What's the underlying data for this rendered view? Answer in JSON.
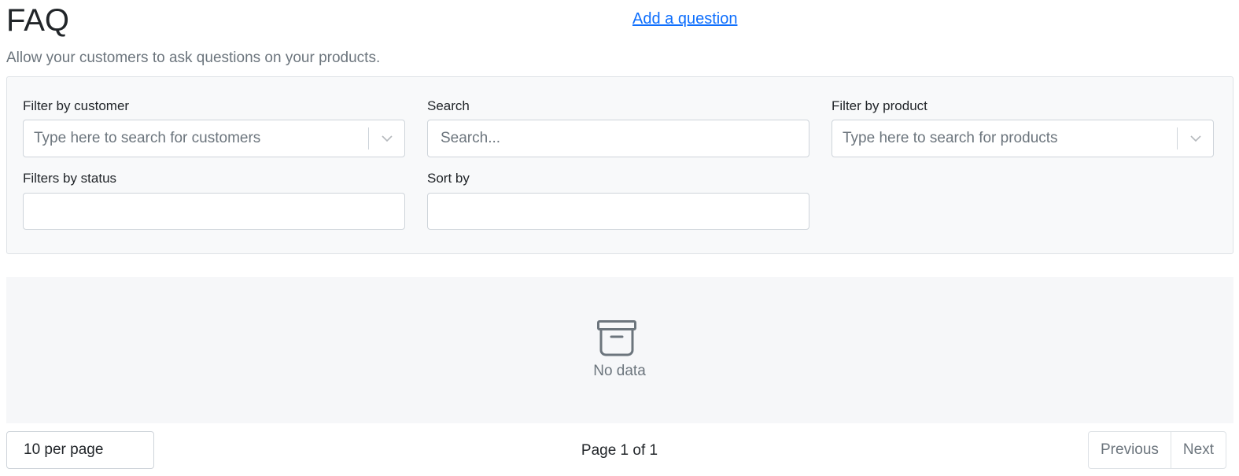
{
  "header": {
    "title": "FAQ",
    "add_link": "Add a question",
    "subtitle": "Allow your customers to ask questions on your products."
  },
  "filters": {
    "customer": {
      "label": "Filter by customer",
      "placeholder": "Type here to search for customers",
      "icon": "chevron-down-icon"
    },
    "search": {
      "label": "Search",
      "placeholder": "Search..."
    },
    "product": {
      "label": "Filter by product",
      "placeholder": "Type here to search for products",
      "icon": "chevron-down-icon"
    },
    "status": {
      "label": "Filters by status",
      "value": ""
    },
    "sort": {
      "label": "Sort by",
      "value": ""
    }
  },
  "empty": {
    "icon": "archive-box-icon",
    "text": "No data"
  },
  "pagination": {
    "per_page": "10 per page",
    "page_info": "Page 1 of 1",
    "previous": "Previous",
    "next": "Next"
  },
  "colors": {
    "link": "#0d6efd",
    "muted": "#6c757d",
    "panel_bg": "#f8f9fa",
    "border": "#ced4da"
  }
}
